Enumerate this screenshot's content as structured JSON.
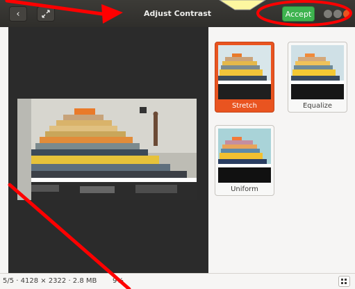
{
  "header": {
    "title": "Adjust Contrast",
    "accept_label": "Accept",
    "back_icon": "chevron-left-icon",
    "fullscreen_icon": "fullscreen-icon"
  },
  "presets": [
    {
      "label": "Stretch",
      "selected": true
    },
    {
      "label": "Equalize",
      "selected": false
    },
    {
      "label": "Uniform",
      "selected": false
    }
  ],
  "status": {
    "info": "5/5 · 4128 × 2322 · 2.8 MB",
    "zoom": "9%"
  },
  "colors": {
    "accent": "#e95420",
    "accept": "#3eb34f",
    "annotation": "#ff0000",
    "callout": "#fdf7a0"
  }
}
